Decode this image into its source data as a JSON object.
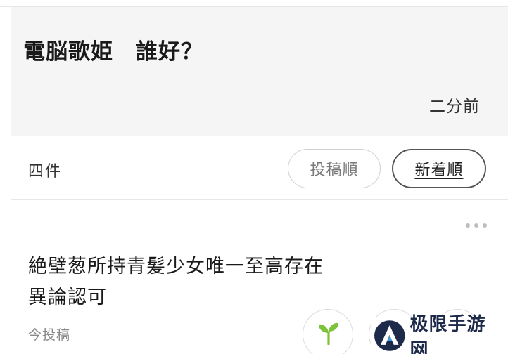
{
  "post": {
    "title": "電脳歌姫　誰好？",
    "time": "二分前"
  },
  "replies_bar": {
    "count": "四件",
    "sort_options": [
      {
        "label": "投稿順",
        "selected": false
      },
      {
        "label": "新着順",
        "selected": true
      }
    ]
  },
  "reply": {
    "lines": [
      "絶壁葱所持青髪少女唯一至高存在",
      "異論認可"
    ],
    "time": "今投稿",
    "more_icon": "more-horizontal-icon",
    "reactions": [
      {
        "icon": "sprout-icon"
      },
      {
        "icon": "reaction-icon"
      },
      {
        "icon": "reaction-icon"
      }
    ]
  },
  "watermark": {
    "text": "极限手游网",
    "logo": "logo-icon"
  },
  "colors": {
    "header_bg": "#f5f5f5",
    "sprout_green": "#7ec23a",
    "watermark_navy": "#1d2a4a"
  }
}
